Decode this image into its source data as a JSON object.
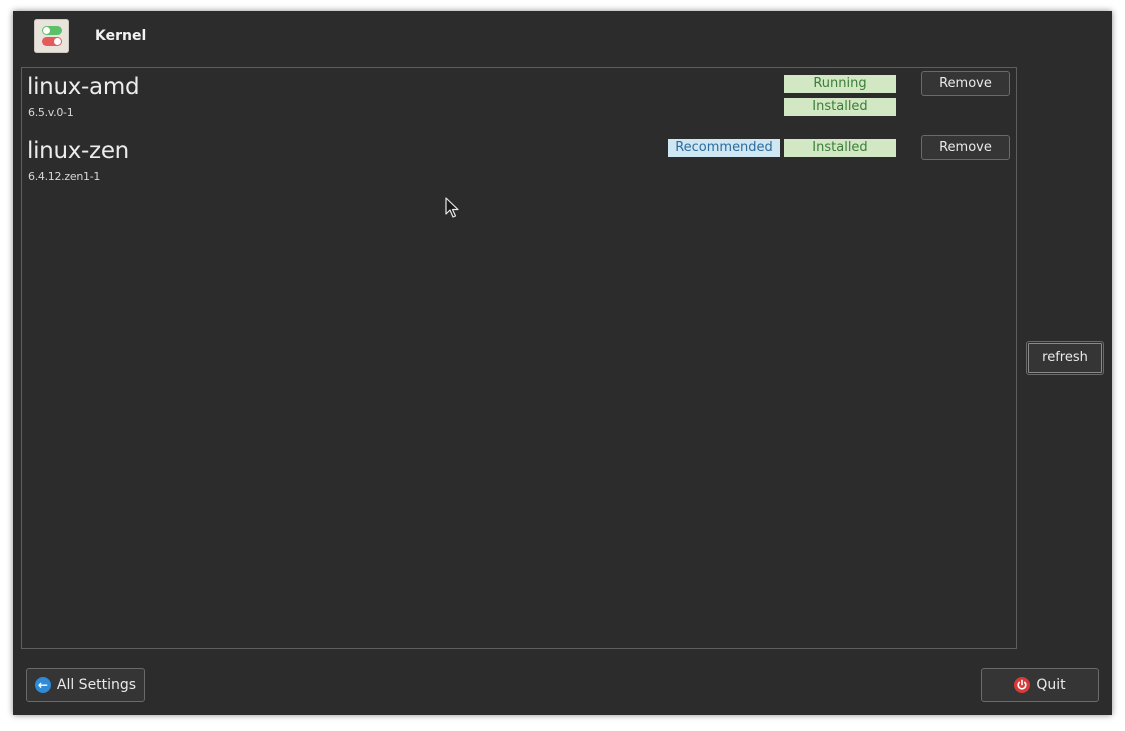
{
  "header": {
    "title": "Kernel",
    "icon": "toggle-switches-icon"
  },
  "kernels": [
    {
      "name": "linux-amd",
      "version": "6.5.v.0-1",
      "badges": [
        "Running",
        "Installed"
      ],
      "action_label": "Remove"
    },
    {
      "name": "linux-zen",
      "version": "6.4.12.zen1-1",
      "badges": [
        "Recommended",
        "Installed"
      ],
      "action_label": "Remove"
    }
  ],
  "sidebar": {
    "refresh_label": "refresh"
  },
  "footer": {
    "all_settings_label": "All Settings",
    "quit_label": "Quit"
  },
  "colors": {
    "window_bg": "#2c2c2c",
    "badge_green_bg": "#d2e8c4",
    "badge_green_text": "#3b7d37",
    "badge_blue_bg": "#cfe6f3",
    "badge_blue_text": "#2d6b9b",
    "back_icon": "#2f8ad8",
    "quit_icon": "#d83a3a"
  }
}
